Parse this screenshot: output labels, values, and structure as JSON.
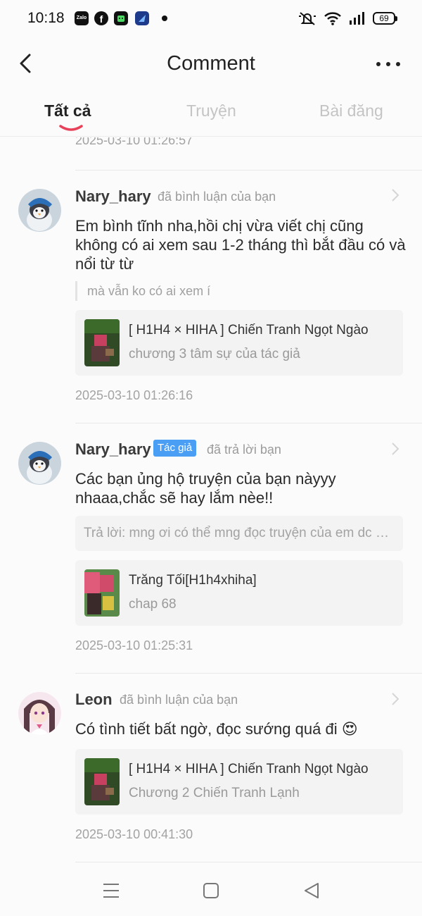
{
  "status_bar": {
    "time": "10:18",
    "app_icons": [
      "zalo-icon",
      "facebook-icon",
      "green-app-icon",
      "blue-app-icon"
    ],
    "zalo_label": "Zalo",
    "fb_label": "f",
    "battery": "69"
  },
  "header": {
    "title": "Comment"
  },
  "tabs": [
    {
      "label": "Tất cả",
      "active": true
    },
    {
      "label": "Truyện",
      "active": false
    },
    {
      "label": "Bài đăng",
      "active": false
    }
  ],
  "feed": {
    "top_timestamp": "2025-03-10 01:26:57",
    "items": [
      {
        "username": "Nary_hary",
        "action": "đã bình luận của bạn",
        "body": "Em bình tĩnh nha,hồi chị vừa viết chị cũng không có ai xem sau 1-2 tháng thì bắt đầu có và nổi từ từ",
        "quote": "mà vẫn ko có ai xem í",
        "story_title": "[ H1H4 × HIHA ] Chiến Tranh Ngọt Ngào",
        "story_chapter": "chương 3 tâm sự của tác giả",
        "timestamp": "2025-03-10 01:26:16"
      },
      {
        "username": "Nary_hary",
        "badge": "Tác giả",
        "action": "đã trả lời bạn",
        "body": "Các bạn ủng hộ truyện của bạn nàyyy nhaaa,chắc sẽ hay lắm nèe!!",
        "reply": "Trả lời: mng ơi có thể mng đọc truyện của em dc không ạ",
        "story_title": "Trăng Tối[H1h4xhiha]",
        "story_chapter": "chap 68",
        "timestamp": "2025-03-10 01:25:31"
      },
      {
        "username": "Leon",
        "action": "đã bình luận của bạn",
        "body": "Có tình tiết bất ngờ, đọc sướng quá đi 😍",
        "story_title": "[ H1H4 × HIHA ] Chiến Tranh Ngọt Ngào",
        "story_chapter": "Chương 2 Chiến Tranh Lạnh",
        "timestamp": "2025-03-10 00:41:30"
      }
    ]
  },
  "colors": {
    "accent": "#e8425a",
    "badge": "#4a9ff5",
    "card_bg": "#f3f3f3",
    "muted_text": "#a3a3a3"
  }
}
